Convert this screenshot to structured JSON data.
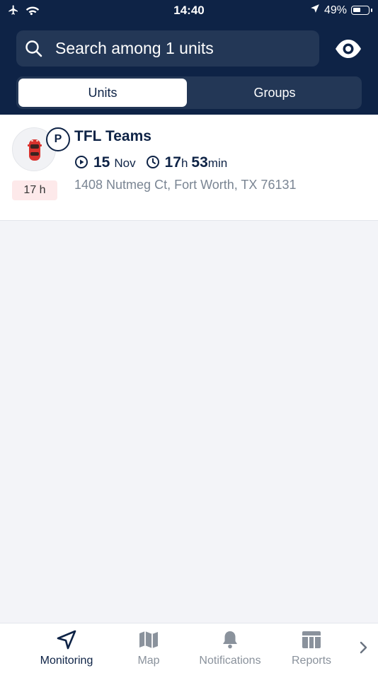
{
  "status_bar": {
    "time": "14:40",
    "battery": "49%",
    "icons": [
      "airplane-icon",
      "wifi-icon",
      "location-arrow-icon",
      "battery-icon"
    ]
  },
  "search": {
    "placeholder": "Search among 1 units",
    "value": ""
  },
  "segments": [
    {
      "label": "Units",
      "active": true
    },
    {
      "label": "Groups",
      "active": false
    }
  ],
  "unit": {
    "name": "TFL Teams",
    "status_letter": "P",
    "date_day": "15",
    "date_month": "Nov",
    "time_hours": "17",
    "time_hours_unit": "h",
    "time_minutes": "53",
    "time_minutes_unit": "min",
    "address": "1408 Nutmeg Ct, Fort Worth, TX 76131",
    "duration_badge": "17 h"
  },
  "tabbar": {
    "items": [
      {
        "label": "Monitoring",
        "icon": "navigation-arrow-icon",
        "active": true
      },
      {
        "label": "Map",
        "icon": "map-icon",
        "active": false
      },
      {
        "label": "Notifications",
        "icon": "bell-icon",
        "active": false
      },
      {
        "label": "Reports",
        "icon": "table-icon",
        "active": false
      }
    ],
    "more_icon": "chevron-right-icon"
  },
  "colors": {
    "header": "#0e2346",
    "header_control": "#233756",
    "accent": "#0e2346",
    "badge_bg": "#fde9ea",
    "background": "#f3f4f8"
  }
}
